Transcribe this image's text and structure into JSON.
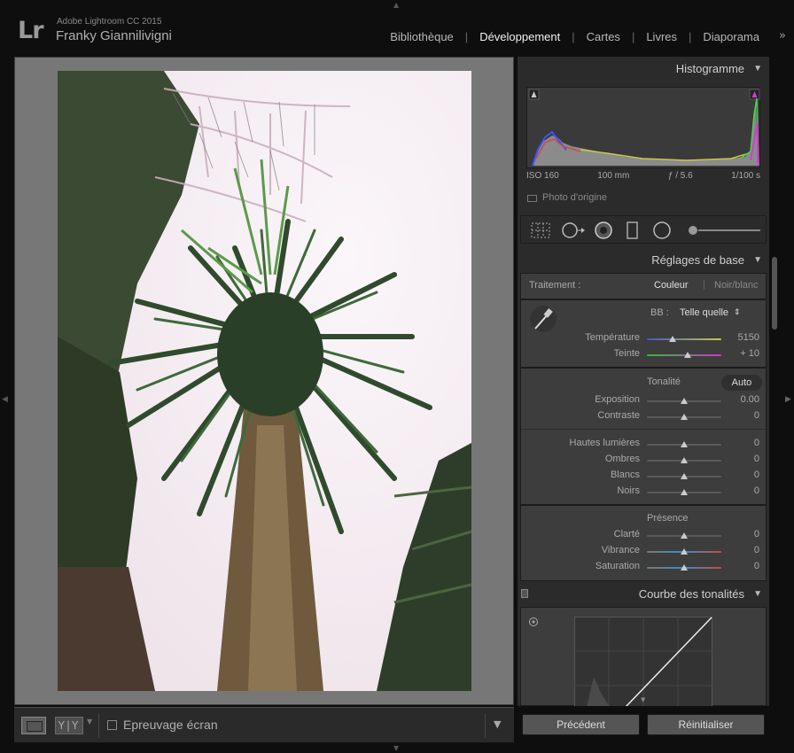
{
  "app": {
    "logo": "Lr",
    "name": "Adobe Lightroom CC 2015",
    "user": "Franky Giannilivigni",
    "modules": [
      "Bibliothèque",
      "Développement",
      "Cartes",
      "Livres",
      "Diaporama"
    ],
    "active_module": "Développement",
    "more_icon": "double-chevron-right-icon"
  },
  "toolbar": {
    "yy_label": "Y|Y",
    "proof_label": "Epreuvage écran"
  },
  "histogram": {
    "title": "Histogramme",
    "iso": "ISO 160",
    "focal": "100 mm",
    "aperture": "ƒ / 5.6",
    "shutter": "1/100 s",
    "original_label": "Photo d'origine"
  },
  "basic": {
    "title": "Réglages de base",
    "treatment_label": "Traitement :",
    "color_option": "Couleur",
    "bw_option": "Noir/blanc",
    "wb_label": "BB :",
    "wb_value": "Telle quelle",
    "wb_dropdown_icon": "updown-chevron-icon",
    "temperature": {
      "label": "Température",
      "value": "5150",
      "level": 0.35
    },
    "tint": {
      "label": "Teinte",
      "value": "+ 10",
      "level": 0.55
    },
    "tone_label": "Tonalité",
    "auto_label": "Auto",
    "exposure": {
      "label": "Exposition",
      "value": "0.00",
      "level": 0.5
    },
    "contrast": {
      "label": "Contraste",
      "value": "0",
      "level": 0.5
    },
    "highlights": {
      "label": "Hautes lumières",
      "value": "0",
      "level": 0.5
    },
    "shadows": {
      "label": "Ombres",
      "value": "0",
      "level": 0.5
    },
    "whites": {
      "label": "Blancs",
      "value": "0",
      "level": 0.5
    },
    "blacks": {
      "label": "Noirs",
      "value": "0",
      "level": 0.5
    },
    "presence_label": "Présence",
    "clarity": {
      "label": "Clarté",
      "value": "0",
      "level": 0.5
    },
    "vibrance": {
      "label": "Vibrance",
      "value": "0",
      "level": 0.5
    },
    "saturation": {
      "label": "Saturation",
      "value": "0",
      "level": 0.5
    }
  },
  "tone_curve": {
    "title": "Courbe des tonalités"
  },
  "buttons": {
    "previous": "Précédent",
    "reset": "Réinitialiser"
  }
}
